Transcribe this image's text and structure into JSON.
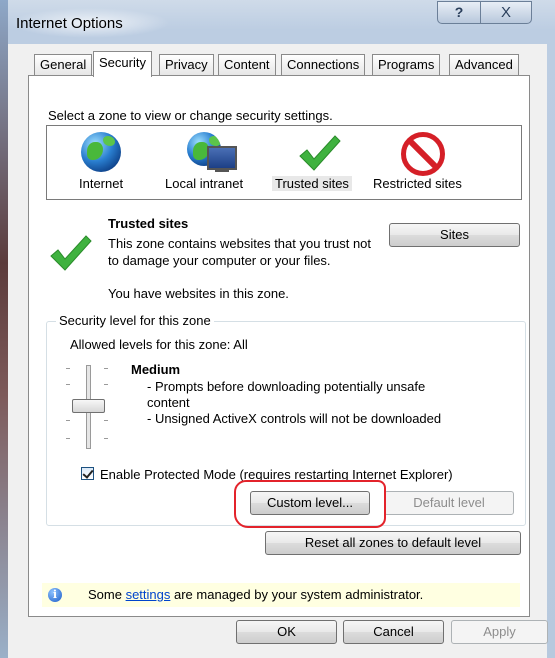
{
  "window": {
    "title": "Internet Options"
  },
  "titlebar": {
    "help_glyph": "?",
    "close_glyph": "X"
  },
  "tabs": [
    {
      "label": "General"
    },
    {
      "label": "Security"
    },
    {
      "label": "Privacy"
    },
    {
      "label": "Content"
    },
    {
      "label": "Connections"
    },
    {
      "label": "Programs"
    },
    {
      "label": "Advanced"
    }
  ],
  "active_tab": "Security",
  "zones": {
    "prompt": "Select a zone to view or change security settings.",
    "items": [
      {
        "label": "Internet",
        "icon": "globe-icon"
      },
      {
        "label": "Local intranet",
        "icon": "intranet-icon"
      },
      {
        "label": "Trusted sites",
        "icon": "checkmark-icon"
      },
      {
        "label": "Restricted sites",
        "icon": "restricted-icon"
      }
    ],
    "selected": "Trusted sites"
  },
  "zone_info": {
    "title": "Trusted sites",
    "description": "This zone contains websites that you trust not to damage your computer or your files.",
    "websites_note": "You have websites in this zone.",
    "sites_button": "Sites"
  },
  "security_level": {
    "group_label": "Security level for this zone",
    "allowed": "Allowed levels for this zone: All",
    "level_name": "Medium",
    "desc_line1": "- Prompts before downloading potentially unsafe",
    "desc_line1b": "content",
    "desc_line2": "- Unsigned ActiveX controls will not be downloaded",
    "protected_mode_label": "Enable Protected Mode (requires restarting Internet Explorer)",
    "protected_mode_checked": true,
    "custom_level_button": "Custom level...",
    "default_level_button": "Default level"
  },
  "reset_button": "Reset all zones to default level",
  "info_bar": {
    "prefix": "Some ",
    "link": "settings",
    "suffix": " are managed by your system administrator.",
    "icon_glyph": "i"
  },
  "footer": {
    "ok": "OK",
    "cancel": "Cancel",
    "apply": "Apply"
  },
  "colors": {
    "annotation": "#e3232b",
    "info_bar_bg": "#ffffe1",
    "check": "#3fb23f",
    "restricted": "#d51f27"
  }
}
